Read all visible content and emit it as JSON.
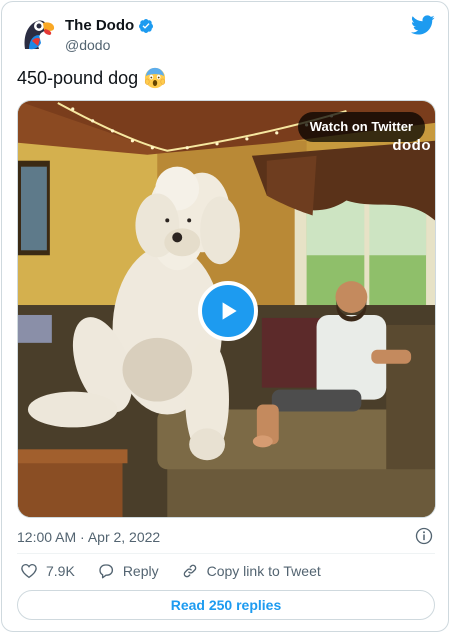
{
  "account": {
    "name": "The Dodo",
    "handle": "@dodo",
    "verified": true
  },
  "tweet": {
    "text": "450-pound dog",
    "emoji": "scream-face-emoji",
    "timestamp": "12:00 AM · Apr 2, 2022"
  },
  "media": {
    "watch_label": "Watch on Twitter",
    "brand_watermark": "dodo"
  },
  "actions": {
    "like_count": "7.9K",
    "reply_label": "Reply",
    "copy_link_label": "Copy link to Tweet"
  },
  "replies_button": "Read 250 replies",
  "colors": {
    "twitter_blue": "#1d9bf0",
    "text_secondary": "#536471",
    "border": "#cfd9de"
  }
}
